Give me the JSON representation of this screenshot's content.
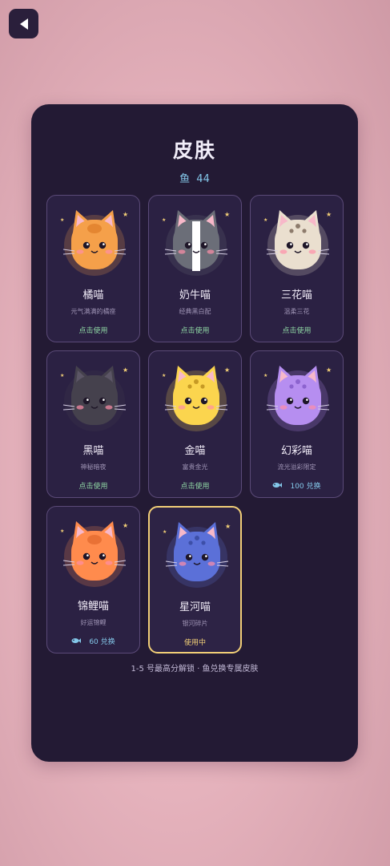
{
  "header": {
    "back_icon": "back-arrow-icon"
  },
  "panel": {
    "title": "皮肤",
    "fish_label": "鱼",
    "fish_count": "44",
    "footer": "1-5 号最高分解锁 · 鱼兑换专属皮肤"
  },
  "skins": [
    {
      "name": "橘喵",
      "desc": "元气满满的橘座",
      "action": "点击使用",
      "state": "owned",
      "color": "#f5a04a",
      "accent": "#e07f2a",
      "pattern": "orange"
    },
    {
      "name": "奶牛喵",
      "desc": "经典黑白配",
      "action": "点击使用",
      "state": "owned",
      "color": "#6b6e78",
      "accent": "#ffffff",
      "pattern": "cow"
    },
    {
      "name": "三花喵",
      "desc": "温柔三花",
      "action": "点击使用",
      "state": "owned",
      "color": "#eadfcf",
      "accent": "#8d7b6c",
      "pattern": "calico"
    },
    {
      "name": "黑喵",
      "desc": "神秘暗夜",
      "action": "点击使用",
      "state": "owned",
      "color": "#45414d",
      "accent": "#2e2a35",
      "pattern": "black"
    },
    {
      "name": "金喵",
      "desc": "富贵金光",
      "action": "点击使用",
      "state": "owned",
      "color": "#fbd54e",
      "accent": "#c69a25",
      "pattern": "gold"
    },
    {
      "name": "幻彩喵",
      "desc": "流光溢彩限定",
      "action": "100 兑换",
      "state": "price",
      "color": "#b68ef0",
      "accent": "#8c63cf",
      "pattern": "rainbow"
    },
    {
      "name": "锦鲤喵",
      "desc": "好运锦鲤",
      "action": "60 兑换",
      "state": "price",
      "color": "#ff8b4d",
      "accent": "#e46a30",
      "pattern": "koi"
    },
    {
      "name": "星河喵",
      "desc": "银河碎片",
      "action": "使用中",
      "state": "in-use",
      "color": "#5b70d8",
      "accent": "#3d4fa8",
      "pattern": "galaxy"
    }
  ]
}
